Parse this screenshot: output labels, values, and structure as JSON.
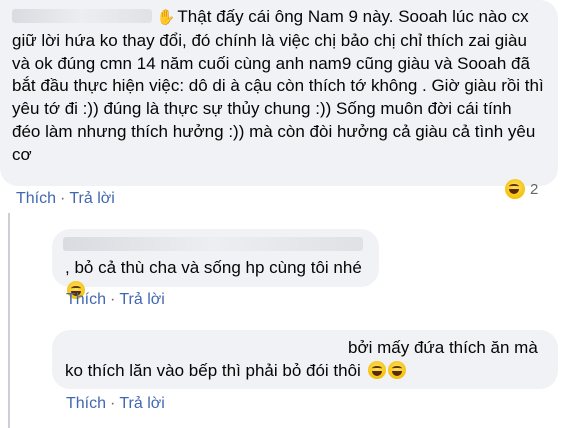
{
  "comment1": {
    "text": "Thật đấy cái ông Nam 9 này. Sooah lúc nào cx giữ lời hứa ko thay đổi, đó chính là việc chị bảo chị chỉ thích zai giàu và ok đúng cmn 14 năm cuối cùng anh nam9 cũng giàu và Sooah đã bắt đầu thực hiện việc: dô di à cậu còn thích tớ không . Giờ giàu rồi thì yêu tớ đi :)) đúng là thực sự thủy chung :)) Sống muôn đời cái tính đéo làm nhưng thích hưởng :)) mà còn đòi hưởng cả giàu cả tình yêu cơ",
    "reaction_count": "2",
    "like_label": "Thích",
    "reply_label": "Trả lời",
    "separator": "·"
  },
  "reply1": {
    "text_after_name": ", bỏ cả thù cha và sống hp cùng tôi nhé",
    "like_label": "Thích",
    "reply_label": "Trả lời",
    "separator": "·"
  },
  "reply2": {
    "text": "bởi mấy đứa thích ăn mà ko thích lăn vào bếp thì phải bỏ đói thôi",
    "like_label": "Thích",
    "reply_label": "Trả lời",
    "separator": "·"
  },
  "icons": {
    "wave": "waving-hand-icon",
    "laugh": "laughing-emoji-icon",
    "rofl": "rolling-laughing-emoji-icon"
  }
}
